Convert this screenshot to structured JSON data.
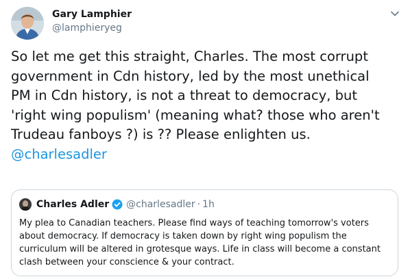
{
  "author": {
    "name": "Gary Lamphier",
    "handle": "@lamphieryeg"
  },
  "tweet": {
    "lines": [
      "So let me get this straight, Charles. The most corrupt",
      "government in Cdn history, led by the most unethical",
      "PM in Cdn history, is not a threat to democracy, but",
      "'right wing populism' (meaning what? those who aren't",
      "Trudeau fanboys ?) is ?? Please enlighten us."
    ],
    "mention": "@charlesadler"
  },
  "quoted_tweet": {
    "name": "Charles Adler",
    "handle": "@charlesadler",
    "separator": "·",
    "time": "1h",
    "lines": [
      "My plea to Canadian teachers. Please find ways of teaching tomorrow's voters",
      "about democracy. If democracy is taken down by right wing populism the",
      "curriculum will be altered in grotesque ways. Life in class will become a constant",
      "clash between your conscience & your contract."
    ]
  },
  "colors": {
    "link": "#1b95e0",
    "secondary_text": "#657786",
    "border": "#ccd6dd",
    "verified": "#1da1f2"
  },
  "icons": {
    "menu": "chevron-down-icon",
    "verified": "verified-badge-icon"
  }
}
